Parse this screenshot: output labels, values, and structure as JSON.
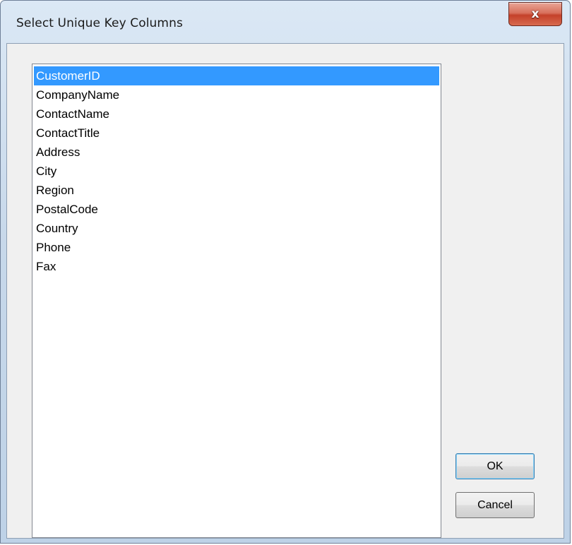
{
  "window": {
    "title": "Select Unique Key Columns",
    "close_label": "x"
  },
  "columns_list": {
    "items": [
      "CustomerID",
      "CompanyName",
      "ContactName",
      "ContactTitle",
      "Address",
      "City",
      "Region",
      "PostalCode",
      "Country",
      "Phone",
      "Fax"
    ],
    "selected": "CustomerID"
  },
  "buttons": {
    "ok_label": "OK",
    "cancel_label": "Cancel"
  },
  "colors": {
    "selection": "#3399ff",
    "close_button": "#c4412a",
    "frame": "#c7d8ea"
  }
}
